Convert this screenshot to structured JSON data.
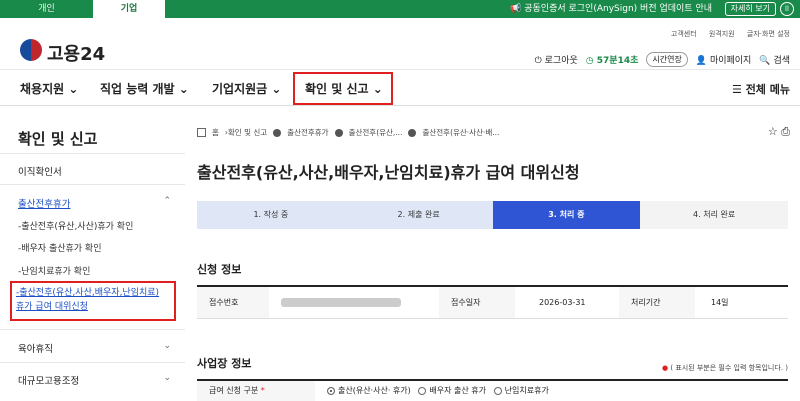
{
  "topbar": {
    "tab_personal": "개인",
    "tab_company": "기업",
    "notice": "공동인증서 로그인(AnySign) 버전 업데이트 안내",
    "more_btn": "자세히 보기",
    "pause_icon": "pause-icon"
  },
  "header": {
    "logo_text": "고용24",
    "util_links": [
      "고객센터",
      "원격지원",
      "글자·화면 설정"
    ],
    "logout": "로그아웃",
    "session_time": "57분14초",
    "extend": "시간연장",
    "mypage": "마이페이지",
    "search": "검색"
  },
  "gnb": {
    "items": [
      "채용지원",
      "직업 능력 개발",
      "기업지원금",
      "확인 및 신고"
    ],
    "all_menu": "전체 메뉴"
  },
  "sidebar": {
    "title": "확인 및 신고",
    "items": [
      "이직확인서",
      "출산전후휴가",
      "육아휴직",
      "대규모고용조정"
    ],
    "sub_items": [
      "출산전후(유산,사산)휴가 확인",
      "배우자 출산휴가 확인",
      "난임치료휴가 확인"
    ],
    "current_line1": "출산전후(유산,사산,배우자,난임치료)",
    "current_line2": "휴가 급여 대위신청"
  },
  "breadcrumb": [
    "홈",
    "확인 및 신고",
    "출산전후휴가",
    "출산전후(유산,...",
    "출산전후(유산·사산·배..."
  ],
  "page": {
    "title": "출산전후(유산,사산,배우자,난임치료)휴가 급여 대위신청"
  },
  "steps": [
    "1. 작성 중",
    "2. 제출 완료",
    "3. 처리 중",
    "4. 처리 완료"
  ],
  "sections": {
    "application": "신청 정보",
    "workplace": "사업장 정보"
  },
  "info_table": {
    "receipt_no_label": "접수번호",
    "receipt_date_label": "접수일자",
    "receipt_date": "2026-03-31",
    "period_label": "처리기간",
    "period": "14일"
  },
  "required_note": "( 표시된 부분은 필수 입력 항목입니다. )",
  "form": {
    "type_label": "급여 신청 구분",
    "options": [
      "출산(유산·사산· 휴가)",
      "배우자 출산 휴가",
      "난임치료휴가"
    ]
  }
}
